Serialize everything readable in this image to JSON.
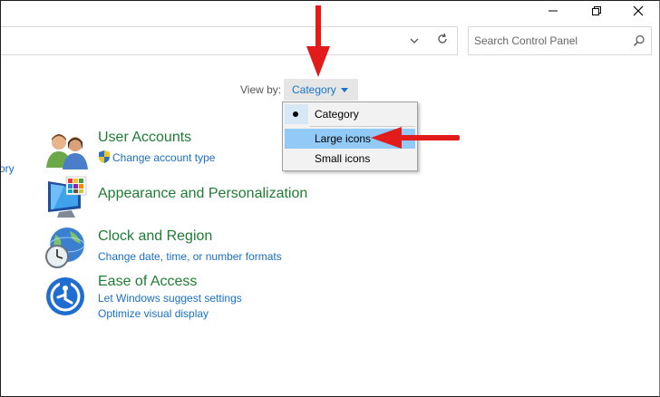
{
  "search": {
    "placeholder": "Search Control Panel"
  },
  "view_by": {
    "label": "View by:",
    "value": "Category"
  },
  "menu": {
    "items": [
      {
        "label": "Category",
        "selected": true
      },
      {
        "label": "Large icons",
        "highlighted": true
      },
      {
        "label": "Small icons"
      }
    ]
  },
  "left_edge_text": "ory",
  "categories": [
    {
      "title": "User Accounts",
      "links": [
        "Change account type"
      ]
    },
    {
      "title": "Appearance and Personalization",
      "links": []
    },
    {
      "title": "Clock and Region",
      "links": [
        "Change date, time, or number formats"
      ]
    },
    {
      "title": "Ease of Access",
      "links": [
        "Let Windows suggest settings",
        "Optimize visual display"
      ]
    }
  ],
  "colors": {
    "link": "#1a6fc8",
    "category_title": "#1e7d35",
    "highlight": "#91c9f7",
    "annotation_arrow": "#e21b1b"
  },
  "icons": [
    "minimize-icon",
    "restore-icon",
    "close-icon",
    "chevron-down-icon",
    "refresh-icon",
    "search-icon",
    "uac-shield-icon",
    "users-icon",
    "monitor-palette-icon",
    "globe-clock-icon",
    "ease-of-access-icon"
  ]
}
